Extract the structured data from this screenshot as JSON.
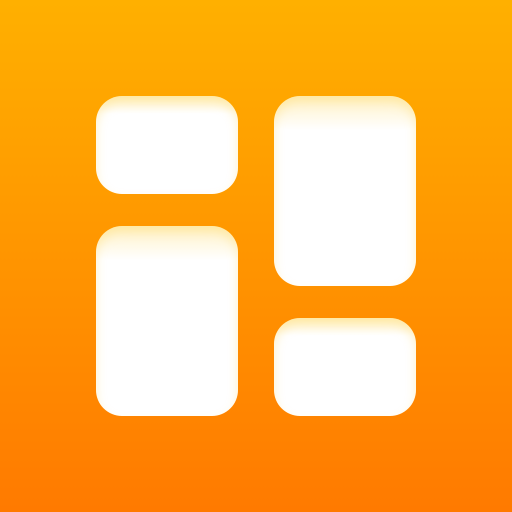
{
  "app_icon": {
    "icon": "layout-grid-icon",
    "colors": {
      "gradient_top": "#FFB000",
      "gradient_bottom": "#FF7A00",
      "tile": "#FFFFFF",
      "tile_highlight": "#FFF2C8"
    },
    "tiles": [
      {
        "name": "tile-top-left"
      },
      {
        "name": "tile-bottom-left"
      },
      {
        "name": "tile-top-right"
      },
      {
        "name": "tile-bottom-right"
      }
    ]
  }
}
